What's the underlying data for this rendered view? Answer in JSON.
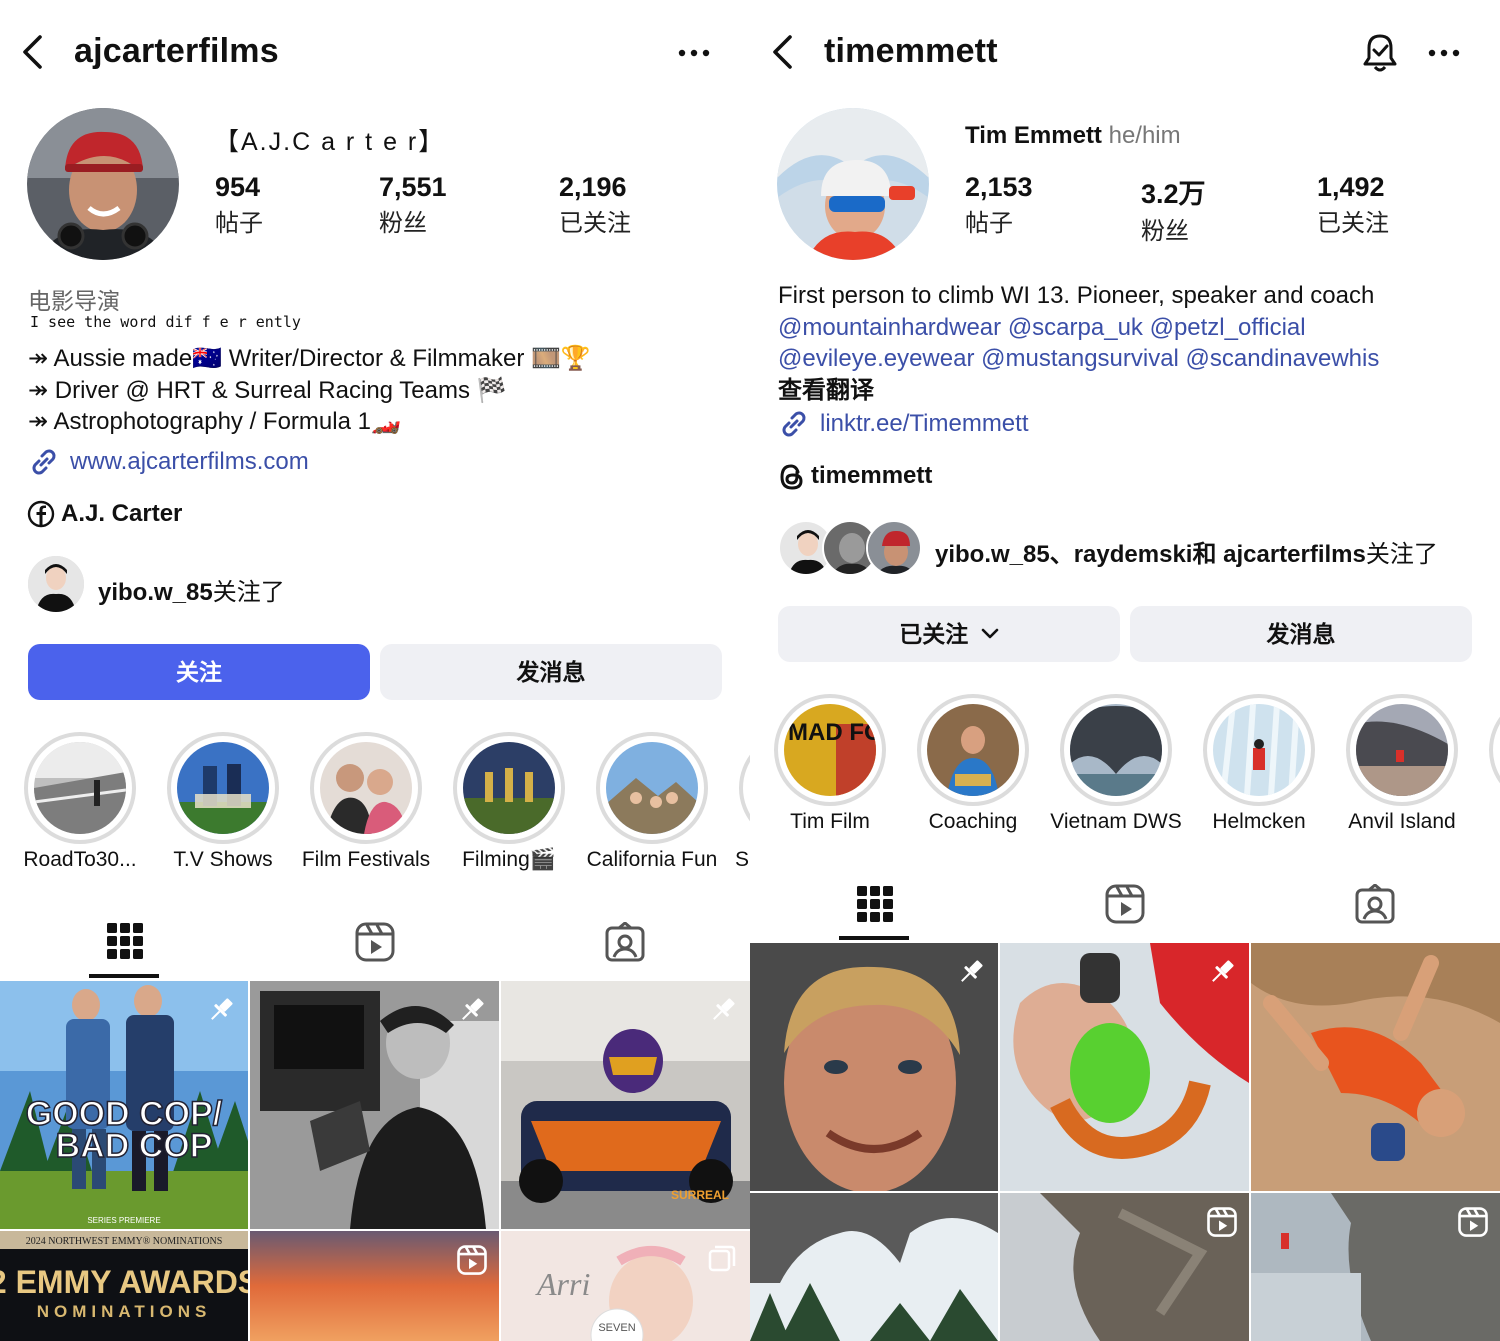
{
  "left": {
    "header": {
      "username": "ajcarterfilms"
    },
    "profile": {
      "display_name": "【A.J.C a r t e r】",
      "stats": [
        {
          "value": "954",
          "label": "帖子"
        },
        {
          "value": "7,551",
          "label": "粉丝"
        },
        {
          "value": "2,196",
          "label": "已关注"
        }
      ],
      "category": "电影导演",
      "tagline": "I see the word dif f e r ently",
      "bio_lines": [
        "↠ Aussie made🇦🇺 Writer/Director & Filmmaker 🎞️🏆",
        "↠ Driver @ HRT & Surreal Racing Teams 🏁",
        "↠ Astrophotography / Formula 1🏎️"
      ],
      "website": "www.ajcarterfilms.com",
      "facebook_name": "A.J. Carter",
      "followed_by_user": "yibo.w_85",
      "followed_by_suffix": "关注了"
    },
    "buttons": {
      "follow": "关注",
      "message": "发消息"
    },
    "highlights": [
      "RoadTo30...",
      "T.V Shows",
      "Film Festivals",
      "Filming🎬",
      "California Fun",
      "S"
    ],
    "grid_texts": {
      "poster_line1": "GOOD COP/",
      "poster_line2": "BAD COP",
      "poster_small": "SERIES PREMIERE",
      "emmy_top": "2024 NORTHWEST EMMY® NOMINATIONS",
      "emmy_main": "2 EMMY AWARDS",
      "emmy_sub": "NOMINATIONS",
      "kart_brand": "SURREAL",
      "baby_script": "Arri",
      "baby_badge": "SEVEN"
    }
  },
  "right": {
    "header": {
      "username": "timemmett"
    },
    "profile": {
      "display_name": "Tim Emmett",
      "pronouns": "he/him",
      "stats": [
        {
          "value": "2,153",
          "label": "帖子"
        },
        {
          "value": "3.2万",
          "label": "粉丝"
        },
        {
          "value": "1,492",
          "label": "已关注"
        }
      ],
      "bio_line": "First person to climb WI 13. Pioneer, speaker and coach",
      "mentions_line1": "@mountainhardwear @scarpa_uk @petzl_official",
      "mentions_line2": "@evileye.eyewear @mustangsurvival @scandinavewhis",
      "translate": "查看翻译",
      "website": "linktr.ee/Timemmett",
      "threads_name": "timemmett",
      "followed_by_text": "yibo.w_85、raydemski和 ajcarterfilms",
      "followed_by_suffix": "关注了"
    },
    "buttons": {
      "following": "已关注",
      "message": "发消息"
    },
    "highlights": [
      "Tim Film",
      "Coaching",
      "Vietnam DWS",
      "Helmcken",
      "Anvil Island"
    ],
    "grid_texts": {
      "film_poster": "MAD FOR IT"
    }
  },
  "colors": {
    "accent_blue": "#4b62ec",
    "link_blue": "#3b4fa8",
    "button_gray": "#eff0f4",
    "ring_gray": "#dcdcdc"
  }
}
